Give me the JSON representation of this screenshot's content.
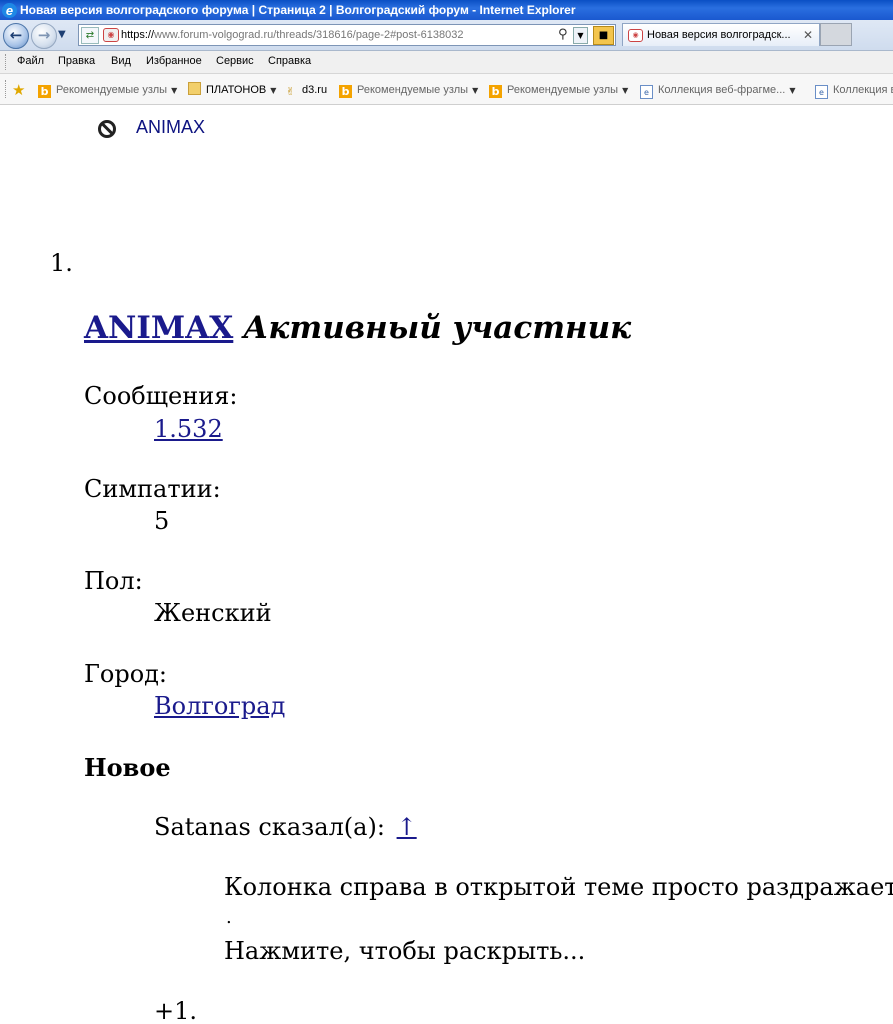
{
  "window": {
    "title": "Новая версия волгоградского форума | Страница 2 | Волгоградский форум - Internet Explorer"
  },
  "browser": {
    "url_prefix": "https://",
    "url_host": "www.forum-volgograd.ru",
    "url_rest": "/threads/318616/page-2#post-6138032",
    "tab_title": "Новая версия волгоградск...",
    "back_icon": "back-arrow-icon",
    "forward_icon": "forward-arrow-icon"
  },
  "menu": {
    "items": [
      "Файл",
      "Правка",
      "Вид",
      "Избранное",
      "Сервис",
      "Справка"
    ]
  },
  "favorites": {
    "items": [
      {
        "label": "Рекомендуемые узлы",
        "icon": "bing-icon",
        "dropdown": true
      },
      {
        "label": "ПЛАТОНОВ",
        "icon": "folder-icon",
        "dropdown": true
      },
      {
        "label": "d3.ru",
        "icon": "d3-icon",
        "dropdown": false
      },
      {
        "label": "Рекомендуемые узлы",
        "icon": "bing-icon",
        "dropdown": true
      },
      {
        "label": "Рекомендуемые узлы",
        "icon": "bing-icon",
        "dropdown": true
      },
      {
        "label": "Коллекция веб-фрагме...",
        "icon": "webslice-icon",
        "dropdown": true
      },
      {
        "label": "Коллекция в",
        "icon": "webslice-icon",
        "dropdown": false
      }
    ]
  },
  "page": {
    "ignored_user": "ANIMAX",
    "list_number": "1.",
    "username": "ANIMAX",
    "user_title": "Активный участник",
    "stats": {
      "messages_label": "Сообщения:",
      "messages_value": "1.532",
      "likes_label": "Симпатии:",
      "likes_value": "5",
      "gender_label": "Пол:",
      "gender_value": "Женский",
      "city_label": "Город:",
      "city_value": "Волгоград"
    },
    "new_label": "Новое",
    "quote": {
      "attribution": "Satanas сказал(а):",
      "arrow": "↑",
      "text": "Колонка справа в открытой теме просто раздражает, зач",
      "dot": ".",
      "expand": "Нажмите, чтобы раскрыть..."
    },
    "plus_one": "+1."
  },
  "colors": {
    "link": "#1a1a8c",
    "titlebar": "#0a4fc4"
  }
}
